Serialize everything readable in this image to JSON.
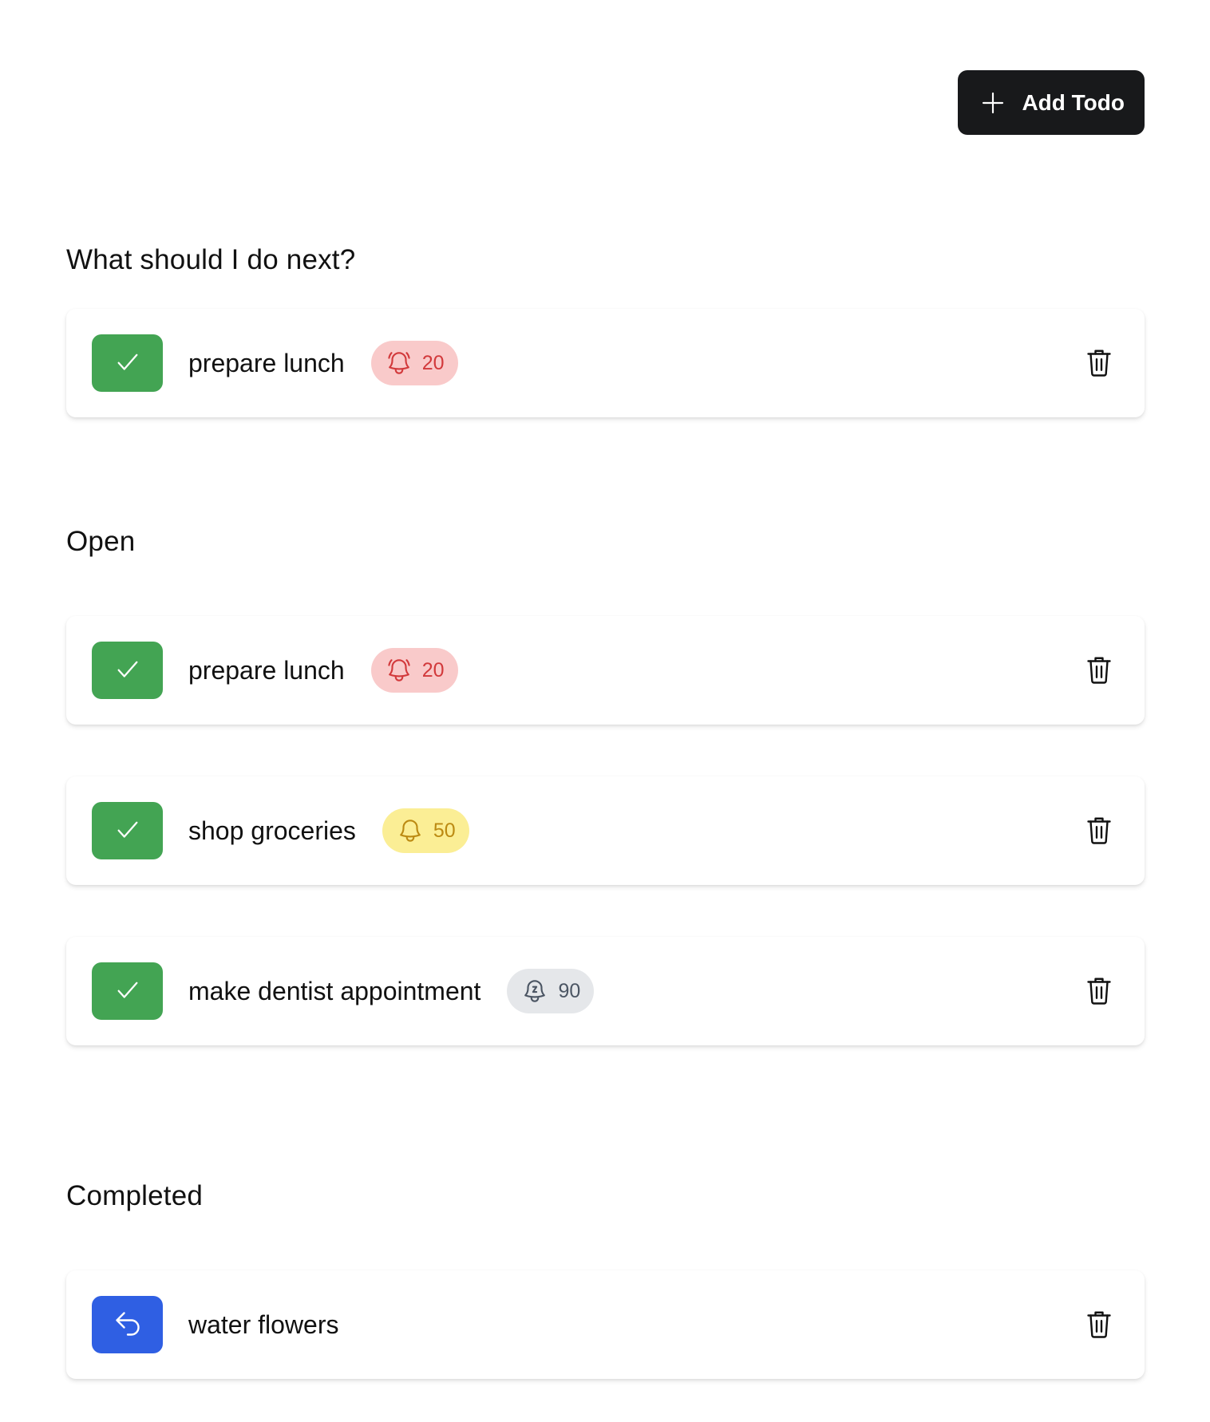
{
  "toolbar": {
    "add_label": "Add Todo",
    "add_icon": "plus-icon"
  },
  "sections": {
    "next": {
      "title": "What should I do next?",
      "items": [
        {
          "text": "prepare lunch",
          "priority": "20",
          "level": "red",
          "icon": "bell-ringing-icon",
          "action": "check-icon"
        }
      ]
    },
    "open": {
      "title": "Open",
      "items": [
        {
          "text": "prepare lunch",
          "priority": "20",
          "level": "red",
          "icon": "bell-ringing-icon",
          "action": "check-icon"
        },
        {
          "text": "shop groceries",
          "priority": "50",
          "level": "yellow",
          "icon": "bell-icon",
          "action": "check-icon"
        },
        {
          "text": "make dentist appointment",
          "priority": "90",
          "level": "gray",
          "icon": "bell-snooze-icon",
          "action": "check-icon"
        }
      ]
    },
    "completed": {
      "title": "Completed",
      "items": [
        {
          "text": "water flowers",
          "action": "undo-icon"
        }
      ]
    }
  },
  "colors": {
    "done_button": "#43a453",
    "undo_button": "#2f5fe3",
    "add_button": "#18191b",
    "badge_red_bg": "#f9caca",
    "badge_red_fg": "#d2393b",
    "badge_yellow_bg": "#fbee95",
    "badge_yellow_fg": "#bc8a12",
    "badge_gray_bg": "#e5e7ea",
    "badge_gray_fg": "#4b5563"
  }
}
